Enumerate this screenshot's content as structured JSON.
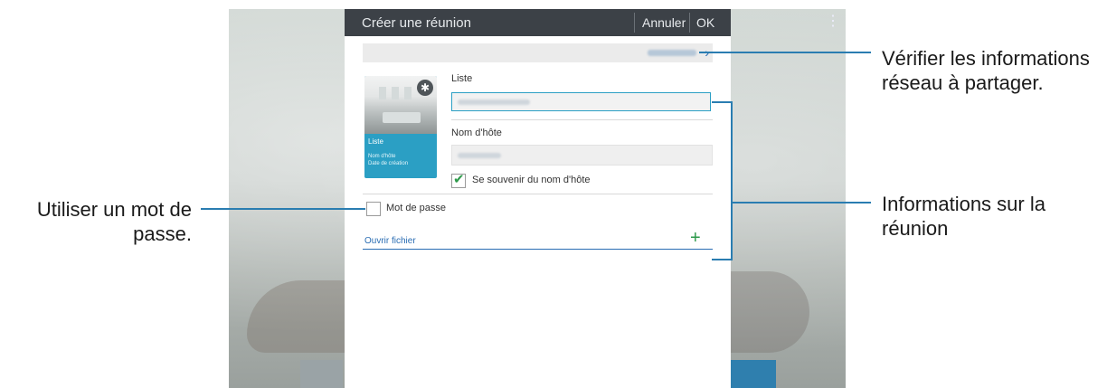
{
  "dialog": {
    "title": "Créer une réunion",
    "cancel_label": "Annuler",
    "ok_label": "OK"
  },
  "card": {
    "title": "Liste",
    "host_line": "Nom d'hôte",
    "date_line": "Date de création"
  },
  "form": {
    "list_label": "Liste",
    "host_label": "Nom d'hôte",
    "remember_label": "Se souvenir du nom d'hôte",
    "remember_checked": true,
    "password_label": "Mot de passe",
    "password_checked": false,
    "open_file_label": "Ouvrir fichier"
  },
  "callouts": {
    "network": "Vérifier les informations réseau à partager.",
    "meeting": "Informations sur la réunion",
    "password": "Utiliser un mot de passe."
  },
  "colors": {
    "accent": "#2b9fc4",
    "link": "#2a6db3",
    "check": "#2e9a4b",
    "titlebar": "#3c4147"
  }
}
